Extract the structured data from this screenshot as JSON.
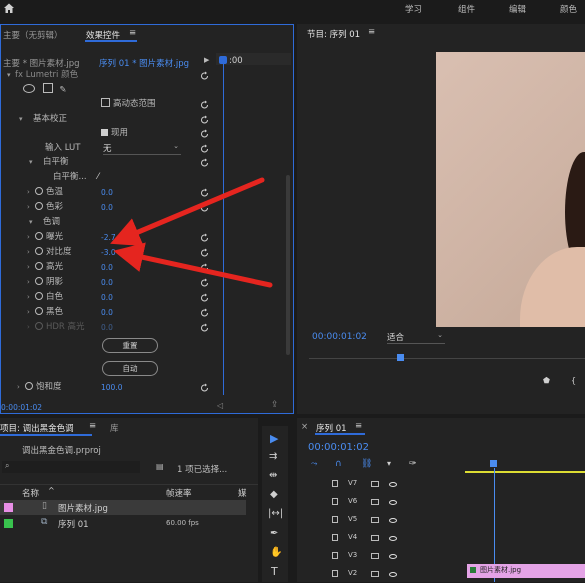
{
  "menu": {
    "items": [
      "学习",
      "组件",
      "编辑",
      "颜色"
    ]
  },
  "effect_controls": {
    "tab_left": "主要（无剪辑）",
    "tab_active": "效果控件",
    "menu_glyph": "≡",
    "clip_source": "主要 * 图片素材.jpg",
    "clip_target": "序列 01 * 图片素材.jpg",
    "play_glyph": "▶",
    "ruler_time": ":00",
    "lumetri": "Lumetri 颜色",
    "hdr_range": "高动态范围",
    "basic_correction": "基本校正",
    "enabled": "现用",
    "input_lut_label": "输入 LUT",
    "input_lut_value": "无",
    "white_balance": "白平衡",
    "wb_picker": "白平衡...",
    "temperature": {
      "label": "色温",
      "value": "0.0"
    },
    "tint": {
      "label": "色彩",
      "value": "0.0"
    },
    "tone": "色调",
    "exposure": {
      "label": "曝光",
      "value": "-2.7"
    },
    "contrast": {
      "label": "对比度",
      "value": "-3.0"
    },
    "highlights": {
      "label": "高光",
      "value": "0.0"
    },
    "shadows": {
      "label": "阴影",
      "value": "0.0"
    },
    "whites": {
      "label": "白色",
      "value": "0.0"
    },
    "blacks": {
      "label": "黑色",
      "value": "0.0"
    },
    "hdr_highlight": {
      "label": "HDR 高光",
      "value": "0.0"
    },
    "reset_button": "重置",
    "auto_button": "自动",
    "saturation": {
      "label": "饱和度",
      "value": "100.0"
    },
    "timecode": "0:00:01:02"
  },
  "program": {
    "title": "节目: 序列 01",
    "menu_glyph": "≡",
    "timecode": "00:00:01:02",
    "fit": "适合",
    "playhead_fraction": 0.32
  },
  "project": {
    "tab": "项目: 调出黑金色调",
    "tab2": "库",
    "menu_glyph": "≡",
    "file": "调出黑金色调.prproj",
    "selected_info": "1 项已选择...",
    "col_name": "名称",
    "col_fps": "帧速率",
    "col_more": "媒",
    "items": [
      {
        "name": "图片素材.jpg",
        "fps": "",
        "color": "#e88fe6"
      },
      {
        "name": "序列 01",
        "fps": "60.00 fps",
        "color": "#39c24e"
      }
    ]
  },
  "timeline": {
    "title": "序列 01",
    "menu_glyph": "≡",
    "timecode": "00:00:01:02",
    "tracks": [
      "V7",
      "V6",
      "V5",
      "V4",
      "V3",
      "V2"
    ],
    "clip_label": "图片素材.jpg",
    "clip_color": "#e4a3e6"
  },
  "colors": {
    "accent": "#2f6bd9",
    "arrow": "#e5251f",
    "timecode": "#4a8cf0"
  }
}
